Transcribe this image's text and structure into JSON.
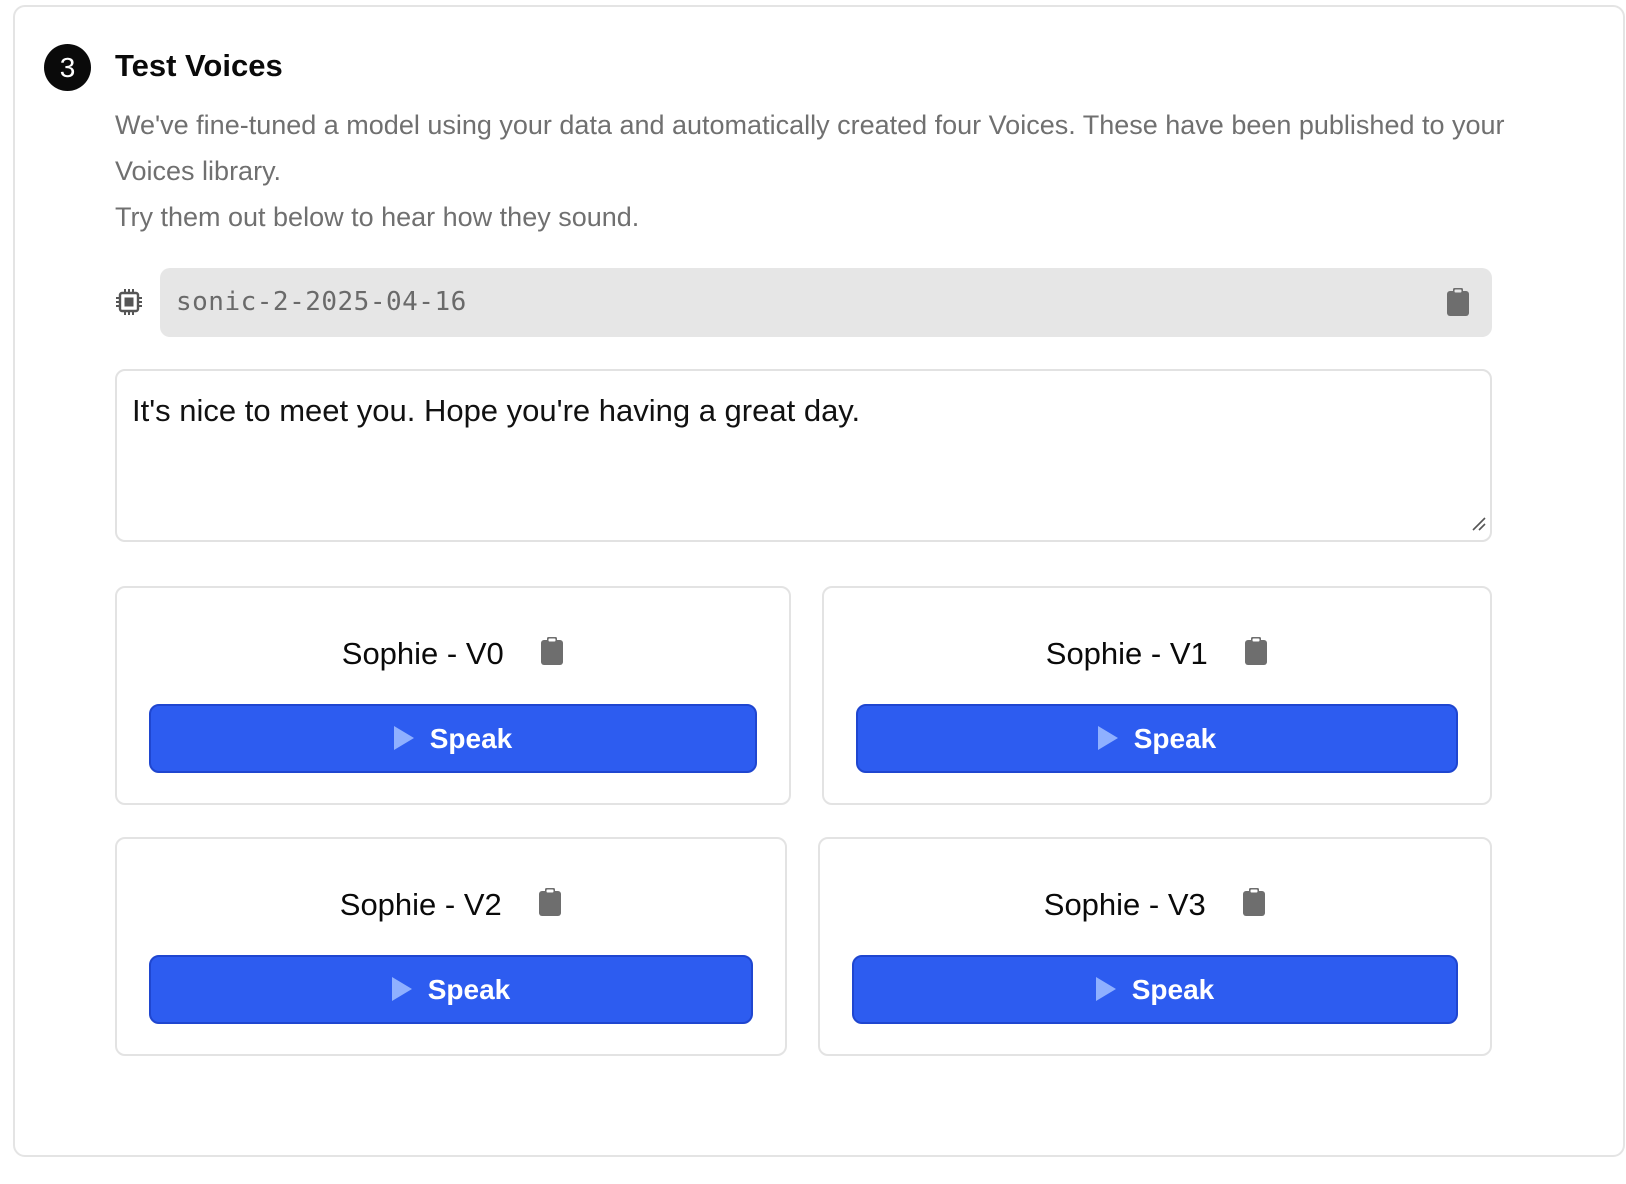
{
  "section": {
    "step_number": "3",
    "title": "Test Voices",
    "description_lines": [
      "We've fine-tuned a model using your data and automatically created four Voices. These have been published to your Voices library.",
      "Try them out below to hear how they sound."
    ]
  },
  "model": {
    "icon": "chip-icon",
    "id": "sonic-2-2025-04-16",
    "copy_icon": "clipboard-icon"
  },
  "transcript": {
    "value": "It's nice to meet you. Hope you're having a great day."
  },
  "voices": [
    {
      "name": "Sophie - V0",
      "button_label": "Speak"
    },
    {
      "name": "Sophie - V1",
      "button_label": "Speak"
    },
    {
      "name": "Sophie - V2",
      "button_label": "Speak"
    },
    {
      "name": "Sophie - V3",
      "button_label": "Speak"
    }
  ],
  "colors": {
    "accent": "#2d5cf0",
    "muted_text": "#707070",
    "field_bg": "#e6e6e6"
  }
}
